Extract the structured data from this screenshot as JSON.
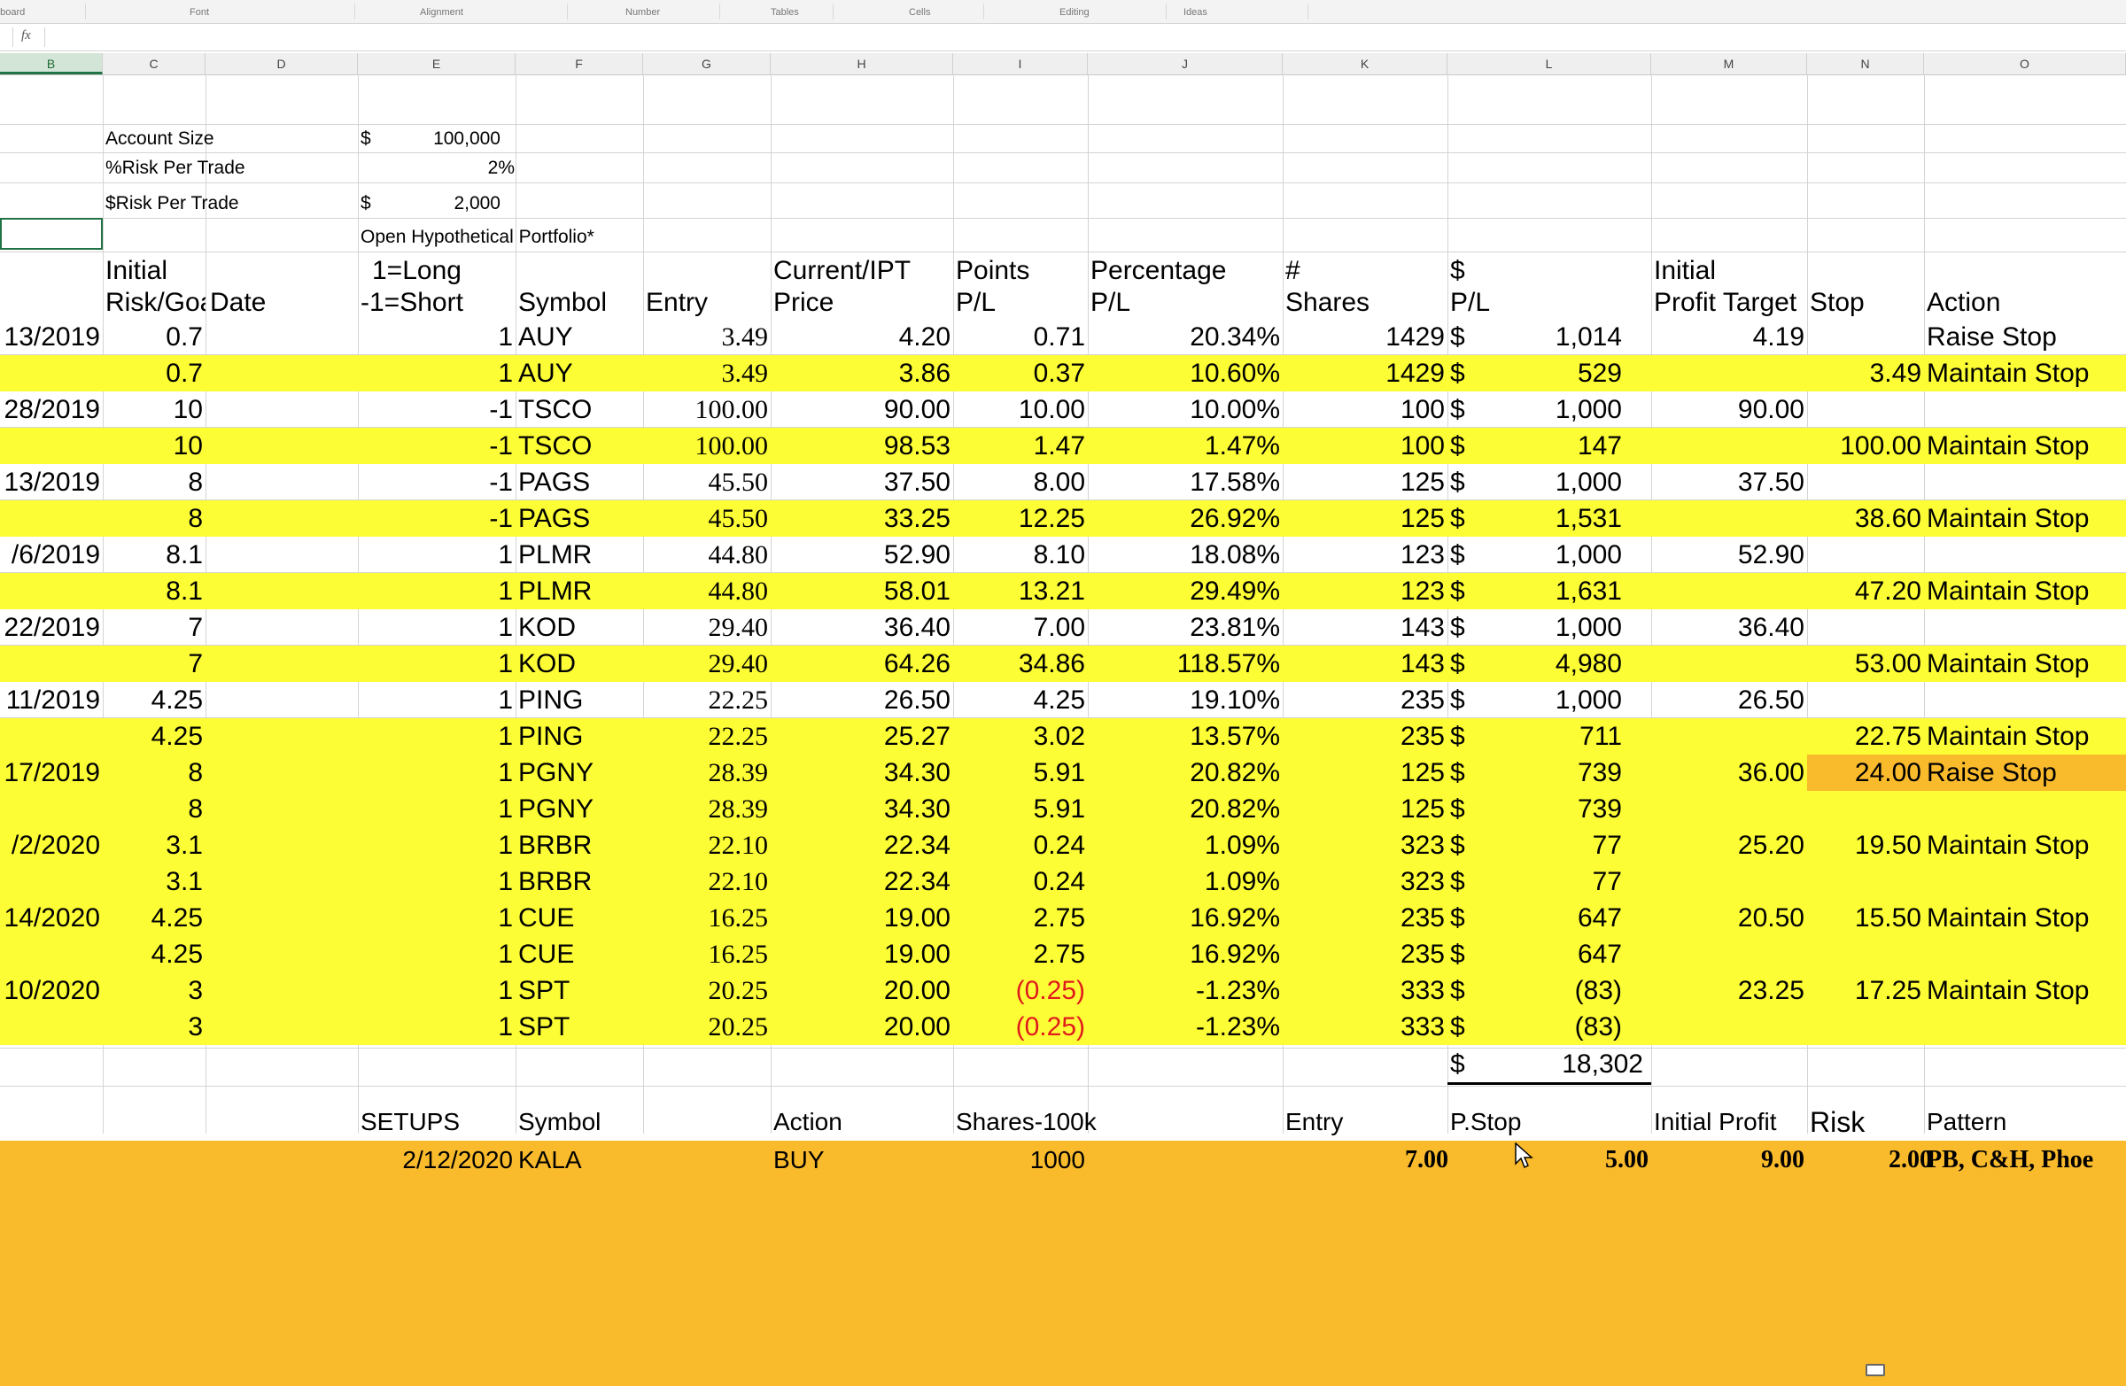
{
  "ribbon": {
    "groups": [
      "pboard",
      "Font",
      "Alignment",
      "Number",
      "Tables",
      "Cells",
      "Editing",
      "Ideas"
    ]
  },
  "formula_bar": {
    "fx": "fx",
    "value": ""
  },
  "columns": [
    "B",
    "C",
    "D",
    "E",
    "F",
    "G",
    "H",
    "I",
    "J",
    "K",
    "L",
    "M",
    "N",
    "O"
  ],
  "selected_column": "B",
  "settings": {
    "account_size_label": "Account Size",
    "account_size_currency": "$",
    "account_size_value": "100,000",
    "risk_pct_label": "%Risk Per Trade",
    "risk_pct_value": "2%",
    "risk_dollar_label": "$Risk Per Trade",
    "risk_dollar_currency": "$",
    "risk_dollar_value": "2,000",
    "portfolio_title": "Open Hypothetical Portfolio*"
  },
  "headers": {
    "initial": "Initial",
    "risk_goal": "Risk/Goal",
    "date": "Date",
    "long": "1=Long",
    "short": "-1=Short",
    "symbol": "Symbol",
    "entry": "Entry",
    "current_ipt": "Current/IPT",
    "price": "Price",
    "points": "Points",
    "points_pl": "P/L",
    "percentage": "Percentage",
    "percentage_pl": "P/L",
    "num": "#",
    "shares": "Shares",
    "dollar": "$",
    "dollar_pl": "P/L",
    "initial2": "Initial",
    "profit_target": "Profit Target",
    "stop": "Stop",
    "action": "Action"
  },
  "rows": [
    {
      "date": "13/2019",
      "risk": "0.7",
      "dir": "1",
      "symbol": "AUY",
      "entry": "3.49",
      "price": "4.20",
      "points": "0.71",
      "pct": "20.34%",
      "shares": "1429",
      "cur": "$",
      "pl": "1,014",
      "target": "4.19",
      "stop": "",
      "action": "Raise Stop",
      "hl": "white"
    },
    {
      "date": "",
      "risk": "0.7",
      "dir": "1",
      "symbol": "AUY",
      "entry": "3.49",
      "price": "3.86",
      "points": "0.37",
      "pct": "10.60%",
      "shares": "1429",
      "cur": "$",
      "pl": "529",
      "target": "",
      "stop": "3.49",
      "action": "Maintain Stop",
      "hl": "yellow"
    },
    {
      "date": "28/2019",
      "risk": "10",
      "dir": "-1",
      "symbol": "TSCO",
      "entry": "100.00",
      "price": "90.00",
      "points": "10.00",
      "pct": "10.00%",
      "shares": "100",
      "cur": "$",
      "pl": "1,000",
      "target": "90.00",
      "stop": "",
      "action": "",
      "hl": "white"
    },
    {
      "date": "",
      "risk": "10",
      "dir": "-1",
      "symbol": "TSCO",
      "entry": "100.00",
      "price": "98.53",
      "points": "1.47",
      "pct": "1.47%",
      "shares": "100",
      "cur": "$",
      "pl": "147",
      "target": "",
      "stop": "100.00",
      "action": "Maintain Stop",
      "hl": "yellow"
    },
    {
      "date": "13/2019",
      "risk": "8",
      "dir": "-1",
      "symbol": "PAGS",
      "entry": "45.50",
      "price": "37.50",
      "points": "8.00",
      "pct": "17.58%",
      "shares": "125",
      "cur": "$",
      "pl": "1,000",
      "target": "37.50",
      "stop": "",
      "action": "",
      "hl": "white"
    },
    {
      "date": "",
      "risk": "8",
      "dir": "-1",
      "symbol": "PAGS",
      "entry": "45.50",
      "price": "33.25",
      "points": "12.25",
      "pct": "26.92%",
      "shares": "125",
      "cur": "$",
      "pl": "1,531",
      "target": "",
      "stop": "38.60",
      "action": "Maintain Stop",
      "hl": "yellow"
    },
    {
      "date": "/6/2019",
      "risk": "8.1",
      "dir": "1",
      "symbol": "PLMR",
      "entry": "44.80",
      "price": "52.90",
      "points": "8.10",
      "pct": "18.08%",
      "shares": "123",
      "cur": "$",
      "pl": "1,000",
      "target": "52.90",
      "stop": "",
      "action": "",
      "hl": "white"
    },
    {
      "date": "",
      "risk": "8.1",
      "dir": "1",
      "symbol": "PLMR",
      "entry": "44.80",
      "price": "58.01",
      "points": "13.21",
      "pct": "29.49%",
      "shares": "123",
      "cur": "$",
      "pl": "1,631",
      "target": "",
      "stop": "47.20",
      "action": "Maintain Stop",
      "hl": "yellow"
    },
    {
      "date": "22/2019",
      "risk": "7",
      "dir": "1",
      "symbol": "KOD",
      "entry": "29.40",
      "price": "36.40",
      "points": "7.00",
      "pct": "23.81%",
      "shares": "143",
      "cur": "$",
      "pl": "1,000",
      "target": "36.40",
      "stop": "",
      "action": "",
      "hl": "white"
    },
    {
      "date": "",
      "risk": "7",
      "dir": "1",
      "symbol": "KOD",
      "entry": "29.40",
      "price": "64.26",
      "points": "34.86",
      "pct": "118.57%",
      "shares": "143",
      "cur": "$",
      "pl": "4,980",
      "target": "",
      "stop": "53.00",
      "action": "Maintain Stop",
      "hl": "yellow"
    },
    {
      "date": "11/2019",
      "risk": "4.25",
      "dir": "1",
      "symbol": "PING",
      "entry": "22.25",
      "price": "26.50",
      "points": "4.25",
      "pct": "19.10%",
      "shares": "235",
      "cur": "$",
      "pl": "1,000",
      "target": "26.50",
      "stop": "",
      "action": "",
      "hl": "white"
    },
    {
      "date": "",
      "risk": "4.25",
      "dir": "1",
      "symbol": "PING",
      "entry": "22.25",
      "price": "25.27",
      "points": "3.02",
      "pct": "13.57%",
      "shares": "235",
      "cur": "$",
      "pl": "711",
      "target": "",
      "stop": "22.75",
      "action": "Maintain Stop",
      "hl": "yellow"
    },
    {
      "date": "17/2019",
      "risk": "8",
      "dir": "1",
      "symbol": "PGNY",
      "entry": "28.39",
      "price": "34.30",
      "points": "5.91",
      "pct": "20.82%",
      "shares": "125",
      "cur": "$",
      "pl": "739",
      "target": "36.00",
      "stop": "24.00",
      "action": "Raise Stop",
      "hl": "yellow",
      "orange_tail": true
    },
    {
      "date": "",
      "risk": "8",
      "dir": "1",
      "symbol": "PGNY",
      "entry": "28.39",
      "price": "34.30",
      "points": "5.91",
      "pct": "20.82%",
      "shares": "125",
      "cur": "$",
      "pl": "739",
      "target": "",
      "stop": "",
      "action": "",
      "hl": "yellow"
    },
    {
      "date": "/2/2020",
      "risk": "3.1",
      "dir": "1",
      "symbol": "BRBR",
      "entry": "22.10",
      "price": "22.34",
      "points": "0.24",
      "pct": "1.09%",
      "shares": "323",
      "cur": "$",
      "pl": "77",
      "target": "25.20",
      "stop": "19.50",
      "action": "Maintain Stop",
      "hl": "yellow"
    },
    {
      "date": "",
      "risk": "3.1",
      "dir": "1",
      "symbol": "BRBR",
      "entry": "22.10",
      "price": "22.34",
      "points": "0.24",
      "pct": "1.09%",
      "shares": "323",
      "cur": "$",
      "pl": "77",
      "target": "",
      "stop": "",
      "action": "",
      "hl": "yellow"
    },
    {
      "date": "14/2020",
      "risk": "4.25",
      "dir": "1",
      "symbol": "CUE",
      "entry": "16.25",
      "price": "19.00",
      "points": "2.75",
      "pct": "16.92%",
      "shares": "235",
      "cur": "$",
      "pl": "647",
      "target": "20.50",
      "stop": "15.50",
      "action": "Maintain Stop",
      "hl": "yellow"
    },
    {
      "date": "",
      "risk": "4.25",
      "dir": "1",
      "symbol": "CUE",
      "entry": "16.25",
      "price": "19.00",
      "points": "2.75",
      "pct": "16.92%",
      "shares": "235",
      "cur": "$",
      "pl": "647",
      "target": "",
      "stop": "",
      "action": "",
      "hl": "yellow"
    },
    {
      "date": "10/2020",
      "risk": "3",
      "dir": "1",
      "symbol": "SPT",
      "entry": "20.25",
      "price": "20.00",
      "points": "(0.25)",
      "pct": "-1.23%",
      "shares": "333",
      "cur": "$",
      "pl": "(83)",
      "target": "23.25",
      "stop": "17.25",
      "action": "Maintain Stop",
      "hl": "yellow",
      "neg_points": true
    },
    {
      "date": "",
      "risk": "3",
      "dir": "1",
      "symbol": "SPT",
      "entry": "20.25",
      "price": "20.00",
      "points": "(0.25)",
      "pct": "-1.23%",
      "shares": "333",
      "cur": "$",
      "pl": "(83)",
      "target": "",
      "stop": "",
      "action": "",
      "hl": "yellow",
      "neg_points": true
    }
  ],
  "total": {
    "currency": "$",
    "value": "18,302"
  },
  "setups_header": {
    "setups": "SETUPS",
    "symbol": "Symbol",
    "action": "Action",
    "shares": "Shares-100k",
    "entry": "Entry",
    "pstop": "P.Stop",
    "initial_profit": "Initial Profit",
    "risk": "Risk",
    "pattern": "Pattern"
  },
  "setups": [
    {
      "date": "2/12/2020",
      "symbol": "KALA",
      "action": "BUY",
      "shares": "1000",
      "entry": "7.00",
      "pstop": "5.00",
      "profit": "9.00",
      "risk": "2.00",
      "pattern": "PB, C&H, Phoe"
    }
  ],
  "colors": {
    "yellow": "#fdfd36",
    "orange": "#f9ba2c",
    "neg": "#e01b1b",
    "select": "#217346"
  }
}
